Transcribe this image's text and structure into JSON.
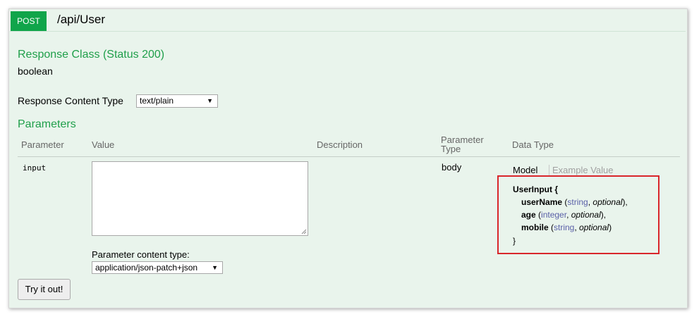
{
  "operation": {
    "method": "POST",
    "path": "/api/User"
  },
  "response_class": {
    "title": "Response Class (Status 200)",
    "type": "boolean"
  },
  "response_content_type": {
    "label": "Response Content Type",
    "selected": "text/plain"
  },
  "parameters": {
    "title": "Parameters",
    "headers": {
      "parameter": "Parameter",
      "value": "Value",
      "description": "Description",
      "parameter_type_line1": "Parameter",
      "parameter_type_line2": "Type",
      "data_type": "Data Type"
    },
    "rows": [
      {
        "name": "input",
        "value": "",
        "parameter_type": "body"
      }
    ],
    "content_type_label": "Parameter content type:",
    "content_type_selected": "application/json-patch+json"
  },
  "data_type": {
    "tab_model": "Model",
    "tab_example": "Example Value",
    "model_name": "UserInput",
    "fields": [
      {
        "name": "userName",
        "type": "string",
        "qualifier": "optional",
        "sep": "),"
      },
      {
        "name": "age",
        "type": "integer",
        "qualifier": "optional",
        "sep": "),"
      },
      {
        "name": "mobile",
        "type": "string",
        "qualifier": "optional",
        "sep": ")"
      }
    ]
  },
  "try_button": "Try it out!"
}
